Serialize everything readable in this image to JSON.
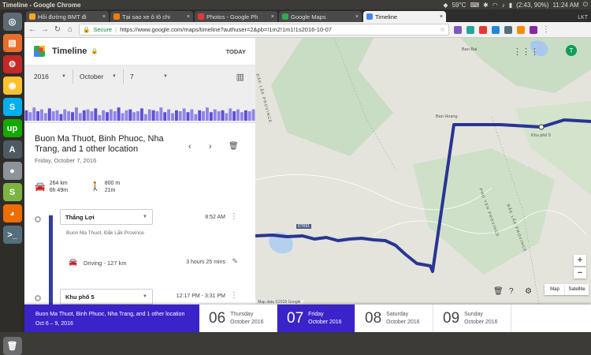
{
  "os": {
    "window_title": "Timeline - Google Chrome",
    "temperature": "59°C",
    "battery": "(2:43, 90%)",
    "clock": "11:24 AM"
  },
  "browser": {
    "tabs": [
      {
        "label": "Hồi đường BMT đi",
        "favicon_color": "#f5a623"
      },
      {
        "label": "Tại sao xe ô tô chi",
        "favicon_color": "#f57c00"
      },
      {
        "label": "Photos - Google Ph",
        "favicon_color": "#e53935"
      },
      {
        "label": "Google Maps",
        "favicon_color": "#34a853"
      },
      {
        "label": "Timeline",
        "favicon_color": "#4285f4"
      }
    ],
    "profile_badge": "LKT",
    "secure_label": "Secure",
    "url": "https://www.google.com/maps/timeline?authuser=2&pb=!1m2!1m1!1s2016-10-07"
  },
  "timeline": {
    "title": "Timeline",
    "today_label": "TODAY",
    "year": "2016",
    "month": "October",
    "day": "7",
    "place_title": "Buon Ma Thuot, Binh Phuoc, Nha Trang, and 1 other location",
    "place_date": "Friday, October 7, 2016",
    "drive_distance": "264 km",
    "drive_time": "6h 49m",
    "walk_distance": "800 m",
    "walk_time": "21m",
    "segments": [
      {
        "name": "Thắng Lợi",
        "time": "8:52 AM",
        "address": "Buon Ma Thuot, Đắk Lắk Province"
      },
      {
        "activity": "Driving",
        "distance": "127 km",
        "duration": "3 hours 25 mins"
      },
      {
        "name": "Khu phố 5",
        "time": "12:17 PM - 3:31 PM"
      }
    ],
    "histogram": [
      0.55,
      0.45,
      0.7,
      0.5,
      0.6,
      0.4,
      0.65,
      0.5,
      0.55,
      0.35,
      0.6,
      0.5,
      0.45,
      0.7,
      0.4,
      0.55,
      0.6,
      0.5,
      0.65,
      0.3,
      0.55,
      0.45,
      0.6,
      0.5,
      0.7,
      0.4,
      0.55,
      0.6,
      0.45,
      0.5,
      0.65,
      0.35,
      0.6,
      0.55,
      0.5,
      0.7,
      0.45,
      0.6,
      0.4,
      0.55,
      0.5,
      0.65,
      0.45,
      0.6,
      0.35,
      0.55,
      0.5,
      0.7,
      0.45,
      0.6,
      0.5,
      0.55,
      0.4,
      0.65,
      0.5,
      0.6,
      0.45,
      0.55,
      0.5,
      0.6
    ]
  },
  "map": {
    "labels": {
      "ban_bai": "Ban Bai",
      "ban_hoang": "Ban Hoang",
      "khu_pho_5": "Khu phố 5",
      "route": "DT691",
      "province_1": "ĐẮK LẮK PROVINCE",
      "province_2": "PHU YEN PROVINCE",
      "province_3": "ĐẮK LẮK PROVINCE"
    },
    "avatar_letter": "T",
    "attribution": "Map data ©2018 Google",
    "map_button": "Map",
    "satellite_button": "Satellite",
    "route_color": "#283593"
  },
  "date_strip": {
    "range_title": "Buon Ma Thuot, Binh Phuoc, Nha Trang, and 1 other location",
    "range_dates": "Oct 6 – 9, 2016",
    "days": [
      {
        "num": "06",
        "weekday": "Thursday",
        "month": "October 2016"
      },
      {
        "num": "07",
        "weekday": "Friday",
        "month": "October 2016",
        "selected": true
      },
      {
        "num": "08",
        "weekday": "Saturday",
        "month": "October 2016"
      },
      {
        "num": "09",
        "weekday": "Sunday",
        "month": "October 2016"
      }
    ]
  }
}
